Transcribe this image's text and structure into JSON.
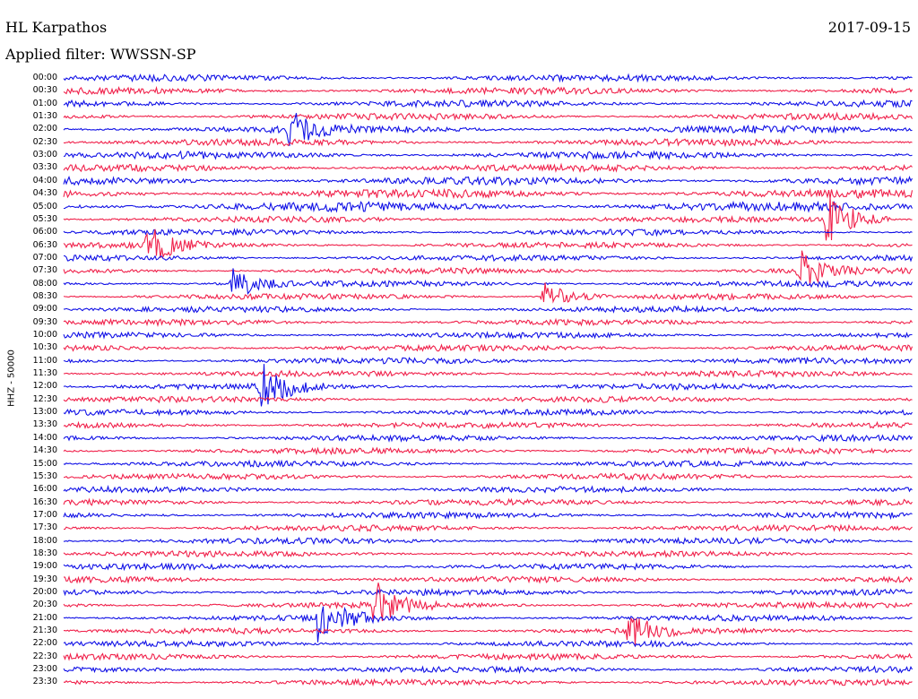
{
  "header": {
    "station": "HL Karpathos",
    "date": "2017-09-15",
    "filter": "Applied filter: WWSSN-SP"
  },
  "axis": {
    "channel_label": "HHZ - 50000"
  },
  "colors": {
    "trace_a": "#1010e6",
    "trace_b": "#f0204a",
    "background": "#ffffff"
  },
  "chart_data": {
    "type": "line",
    "title": "HL Karpathos",
    "subtitle": "Applied filter: WWSSN-SP",
    "ylabel": "HHZ - 50000",
    "row_labels": [
      "00:00",
      "00:30",
      "01:00",
      "01:30",
      "02:00",
      "02:30",
      "03:00",
      "03:30",
      "04:00",
      "04:30",
      "05:00",
      "05:30",
      "06:00",
      "06:30",
      "07:00",
      "07:30",
      "08:00",
      "08:30",
      "09:00",
      "09:30",
      "10:00",
      "10:30",
      "11:00",
      "11:30",
      "12:00",
      "12:30",
      "13:00",
      "13:30",
      "14:00",
      "14:30",
      "15:00",
      "15:30",
      "16:00",
      "16:30",
      "17:00",
      "17:30",
      "18:00",
      "18:30",
      "19:00",
      "19:30",
      "20:00",
      "20:30",
      "21:00",
      "21:30",
      "22:00",
      "22:30",
      "23:00",
      "23:30"
    ],
    "row_minutes": 30,
    "series": [
      {
        "color": "#1010e6"
      },
      {
        "color": "#f0204a"
      }
    ],
    "trace_color_order": [
      "#1010e6",
      "#f0204a"
    ],
    "events": [
      {
        "row": "06:30",
        "minute": 3,
        "amplitude": 3.5,
        "color": "#1010e6"
      },
      {
        "row": "08:00",
        "minute": 6,
        "amplitude": 2.8,
        "color": "#f0204a"
      },
      {
        "row": "08:30",
        "minute": 17,
        "amplitude": 2.5,
        "color": "#1010e6"
      },
      {
        "row": "07:30",
        "minute": 26,
        "amplitude": 3.5,
        "color": "#f0204a"
      },
      {
        "row": "05:30",
        "minute": 27,
        "amplitude": 5.5,
        "color": "#f0204a"
      },
      {
        "row": "12:00",
        "minute": 7,
        "amplitude": 4.5,
        "color": "#1010e6"
      },
      {
        "row": "02:00",
        "minute": 8,
        "amplitude": 3.0,
        "color": "#1010e6"
      },
      {
        "row": "21:00",
        "minute": 9,
        "amplitude": 4.5,
        "color": "#f0204a"
      },
      {
        "row": "20:30",
        "minute": 11,
        "amplitude": 4.0,
        "color": "#f0204a"
      },
      {
        "row": "21:30",
        "minute": 20,
        "amplitude": 3.0,
        "color": "#1010e6"
      }
    ]
  }
}
